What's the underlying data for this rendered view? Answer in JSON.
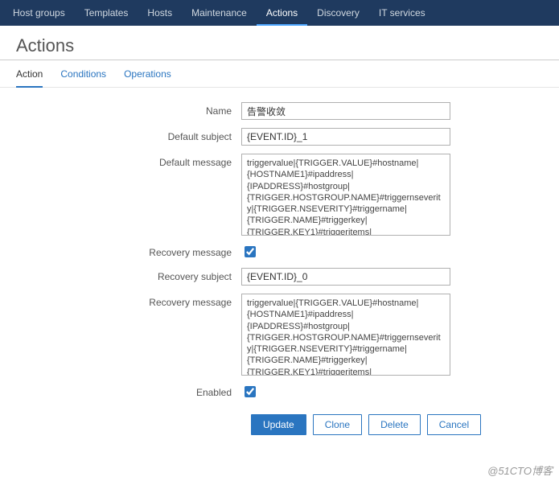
{
  "topnav": {
    "items": [
      {
        "label": "Host groups"
      },
      {
        "label": "Templates"
      },
      {
        "label": "Hosts"
      },
      {
        "label": "Maintenance"
      },
      {
        "label": "Actions"
      },
      {
        "label": "Discovery"
      },
      {
        "label": "IT services"
      }
    ]
  },
  "page": {
    "title": "Actions"
  },
  "tabs": {
    "items": [
      {
        "label": "Action"
      },
      {
        "label": "Conditions"
      },
      {
        "label": "Operations"
      }
    ]
  },
  "form": {
    "name_label": "Name",
    "name_value": "告警收敛",
    "default_subject_label": "Default subject",
    "default_subject_value": "{EVENT.ID}_1",
    "default_message_label": "Default message",
    "default_message_value": "triggervalue|{TRIGGER.VALUE}#hostname|{HOSTNAME1}#ipaddress|{IPADDRESS}#hostgroup|{TRIGGER.HOSTGROUP.NAME}#triggernseverity|{TRIGGER.NSEVERITY}#triggername|{TRIGGER.NAME}#triggerkey|{TRIGGER.KEY1}#triggeritems|{ITEM.NAME}#itemvalue|{ITEM.VALUE}#eventid|",
    "recovery_checkbox_label": "Recovery message",
    "recovery_checked": true,
    "recovery_subject_label": "Recovery subject",
    "recovery_subject_value": "{EVENT.ID}_0",
    "recovery_message_label": "Recovery message",
    "recovery_message_value": "triggervalue|{TRIGGER.VALUE}#hostname|{HOSTNAME1}#ipaddress|{IPADDRESS}#hostgroup|{TRIGGER.HOSTGROUP.NAME}#triggernseverity|{TRIGGER.NSEVERITY}#triggername|{TRIGGER.NAME}#triggerkey|{TRIGGER.KEY1}#triggeritems|{ITEM.NAME}#itemvalue|{ITEM.VALUE}#eventid|",
    "enabled_label": "Enabled",
    "enabled_checked": true
  },
  "buttons": {
    "update": "Update",
    "clone": "Clone",
    "delete": "Delete",
    "cancel": "Cancel"
  },
  "watermark": "@51CTO博客"
}
